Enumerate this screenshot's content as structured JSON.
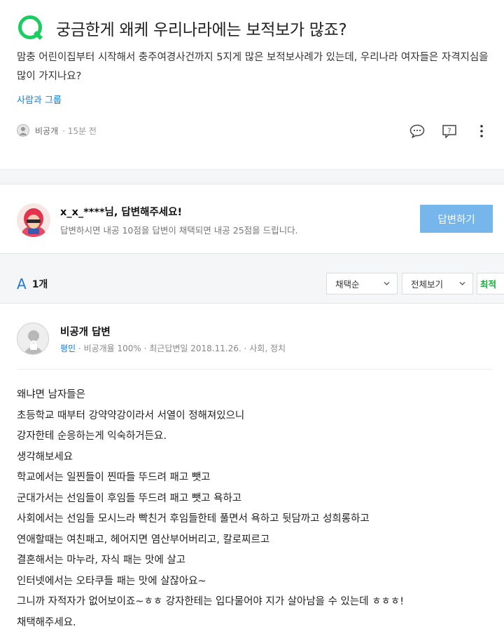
{
  "question": {
    "title": "궁금한게 왜케 우리나라에는 보적보가 많죠?",
    "body": "맘충 어린이집부터 시작해서 충주여경사건까지 5지게 많은 보적보사례가 있는데, 우리나라 여자들은 자격지심을 많이 가지나요?",
    "tag": "사람과 그룹",
    "author": "비공개",
    "time": "· 15분 전",
    "icons": [
      "comment-icon",
      "report-icon",
      "more-icon"
    ]
  },
  "prompt": {
    "name": "x_x_****님, 답변해주세요!",
    "desc": "답변하시면 내공 10점을 답변이 채택되면 내공 25점을 드립니다.",
    "button": "답변하기"
  },
  "answers_header": {
    "letter": "A",
    "count": "1개",
    "sort_select": "채택순",
    "filter_select": "전체보기",
    "latest": "최적"
  },
  "answer": {
    "title": "비공개 답변",
    "rank": "평민",
    "meta": " · 비공개율 100% · 최근답변일 2018.11.26. · 사회, 정치",
    "lines": [
      "왜냐면 남자들은",
      "초등학교 때부터 강약약강이라서 서열이 정해져있으니",
      "강자한테 순응하는게 익숙하거든요.",
      "생각해보세요",
      "학교에서는 일찐들이 찐따들 뚜드려 패고 뺏고",
      "군대가서는 선임들이 후임들 뚜드려 패고 뺏고 욕하고",
      "사회에서는 선임들 모시느라 빡친거 후임들한테 풀면서 욕하고 뒷담까고 성희롱하고",
      "연애할때는 여친패고, 헤어지면 염산부어버리고, 칼로찌르고",
      "결혼해서는 마누라, 자식 패는 맛에 살고",
      "인터넷에서는 오타쿠들 패는 맛에 살잖아요~",
      "그니까 자적자가 없어보이죠~ㅎㅎ 강자한테는 입다물어야 지가 살아남을 수 있는데 ㅎㅎㅎ!",
      "채택해주세요."
    ]
  },
  "colors": {
    "brand_green": "#19ce60",
    "link_blue": "#1a7bdc",
    "answer_button": "#76b6ec"
  }
}
